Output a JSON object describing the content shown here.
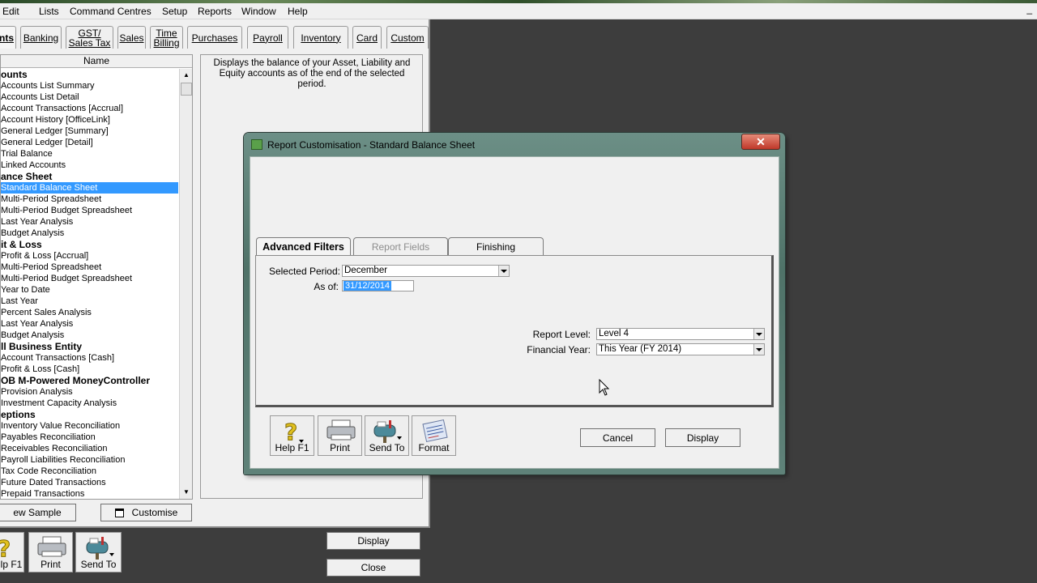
{
  "menubar": {
    "items": [
      "Edit",
      "Lists",
      "Command Centres",
      "Setup",
      "Reports",
      "Window",
      "Help"
    ]
  },
  "tabs": [
    {
      "label": "nts"
    },
    {
      "label": "Banking"
    },
    {
      "label": "GST/ Sales Tax",
      "line1": "GST/",
      "line2": "Sales Tax"
    },
    {
      "label": "Sales"
    },
    {
      "label": "Time Billing",
      "line1": "Time",
      "line2": "Billing"
    },
    {
      "label": "Purchases"
    },
    {
      "label": "Payroll"
    },
    {
      "label": "Inventory"
    },
    {
      "label": "Card"
    },
    {
      "label": "Custom"
    }
  ],
  "report_list": {
    "header": "Name",
    "rows": [
      {
        "text": "ounts",
        "type": "heading"
      },
      {
        "text": "Accounts List Summary"
      },
      {
        "text": "Accounts List Detail"
      },
      {
        "text": "Account Transactions [Accrual]"
      },
      {
        "text": "Account History [OfficeLink]"
      },
      {
        "text": "General Ledger [Summary]"
      },
      {
        "text": "General Ledger [Detail]"
      },
      {
        "text": "Trial Balance"
      },
      {
        "text": "Linked Accounts"
      },
      {
        "text": "ance Sheet",
        "type": "heading"
      },
      {
        "text": "Standard Balance Sheet",
        "selected": true
      },
      {
        "text": "Multi-Period Spreadsheet"
      },
      {
        "text": "Multi-Period Budget Spreadsheet"
      },
      {
        "text": "Last Year Analysis"
      },
      {
        "text": "Budget Analysis"
      },
      {
        "text": "it & Loss",
        "type": "heading"
      },
      {
        "text": "Profit & Loss [Accrual]"
      },
      {
        "text": "Multi-Period Spreadsheet"
      },
      {
        "text": "Multi-Period Budget Spreadsheet"
      },
      {
        "text": "Year to Date"
      },
      {
        "text": "Last Year"
      },
      {
        "text": "Percent Sales Analysis"
      },
      {
        "text": "Last Year Analysis"
      },
      {
        "text": "Budget Analysis"
      },
      {
        "text": "ll Business Entity",
        "type": "heading"
      },
      {
        "text": "Account Transactions [Cash]"
      },
      {
        "text": "Profit & Loss [Cash]"
      },
      {
        "text": "OB M-Powered MoneyController",
        "type": "heading"
      },
      {
        "text": "Provision Analysis"
      },
      {
        "text": "Investment Capacity Analysis"
      },
      {
        "text": "eptions",
        "type": "heading"
      },
      {
        "text": "Inventory Value Reconciliation"
      },
      {
        "text": "Payables Reconciliation"
      },
      {
        "text": "Receivables Reconciliation"
      },
      {
        "text": "Payroll Liabilities Reconciliation"
      },
      {
        "text": "Tax Code Reconciliation"
      },
      {
        "text": "Future Dated Transactions"
      },
      {
        "text": "Prepaid Transactions"
      }
    ]
  },
  "description": "Displays the balance of your Asset, Liability and Equity accounts as of the end of the selected period.",
  "main_buttons": {
    "view_sample": "ew Sample",
    "customise": "Customise",
    "display": "Display",
    "close": "Close"
  },
  "main_toolbar": {
    "help": "lp F1",
    "print": "Print",
    "send_to": "Send To"
  },
  "dialog": {
    "title": "Report Customisation - Standard Balance Sheet",
    "tabs": [
      "Advanced Filters",
      "Report Fields",
      "Finishing"
    ],
    "selected_period_label": "Selected Period:",
    "selected_period_value": "December",
    "as_of_label": "As of:",
    "as_of_value": "31/12/2014",
    "report_level_label": "Report Level:",
    "report_level_value": "Level 4",
    "financial_year_label": "Financial Year:",
    "financial_year_value": "This Year (FY 2014)",
    "toolbar": {
      "help": "Help F1",
      "print": "Print",
      "send_to": "Send To",
      "format": "Format"
    },
    "cancel": "Cancel",
    "display": "Display"
  }
}
